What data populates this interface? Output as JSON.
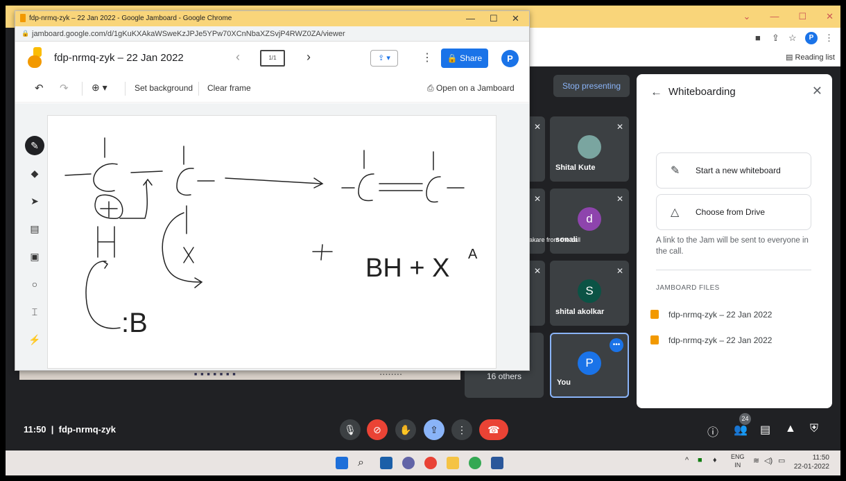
{
  "jamboard_window": {
    "title": "fdp-nrmq-zyk – 22 Jan 2022 - Google Jamboard - Google Chrome",
    "url": "jamboard.google.com/d/1gKuKXAkaWSweKzJPJe5YPw70XCnNbaXZSvjP4RWZ0ZA/viewer",
    "doc_title": "fdp-nrmq-zyk – 22 Jan 2022",
    "frame_indicator": "1/1",
    "share_label": "Share",
    "avatar": "P",
    "toolbar": {
      "set_background": "Set background",
      "clear_frame": "Clear frame",
      "open_on_jamboard": "Open on a Jamboard"
    },
    "tools": [
      "pen-icon",
      "eraser-icon",
      "select-icon",
      "sticky-note-icon",
      "image-icon",
      "circle-icon",
      "text-box-icon",
      "laser-icon"
    ],
    "sketch_texts": {
      "left_result": ":B",
      "right_text": "BH + X",
      "right_sup": "A"
    }
  },
  "meet": {
    "stop_presenting": "Stop presenting",
    "participants": [
      {
        "name": "Shital Kute",
        "muted": true
      },
      {
        "name": "sonali",
        "initial": "d",
        "color": "#8e44ad",
        "muted": true
      },
      {
        "name": "shital akolkar",
        "initial": "S",
        "color": "#0b5345",
        "muted": true
      },
      {
        "name": "You",
        "initial": "P",
        "color": "#1a73e8"
      }
    ],
    "removed_msg": "akare from the call",
    "others_label": "16 others",
    "time": "11:50",
    "meeting_code": "fdp-nrmq-zyk",
    "people_count": "24",
    "browser": {
      "reading_list": "Reading list",
      "avatar": "P"
    }
  },
  "whiteboarding": {
    "title": "Whiteboarding",
    "start_new": "Start a new whiteboard",
    "choose_drive": "Choose from Drive",
    "note": "A link to the Jam will be sent to everyone in the call.",
    "files_header": "JAMBOARD FILES",
    "files": [
      "fdp-nrmq-zyk – 22 Jan 2022",
      "fdp-nrmq-zyk – 22 Jan 2022"
    ]
  },
  "taskbar": {
    "lang": "ENG",
    "region": "IN",
    "time": "11:50",
    "date": "22-01-2022"
  },
  "colors": {
    "meet_bg": "#202124",
    "accent": "#1a73e8",
    "end_call": "#ea4335",
    "chrome_title": "#f9d57a"
  }
}
